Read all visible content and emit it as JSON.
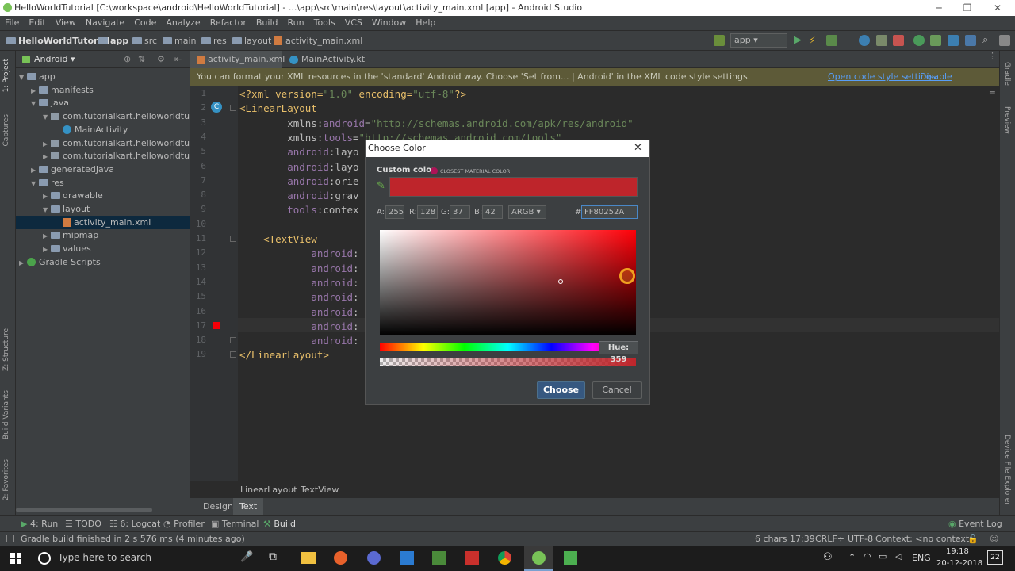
{
  "window": {
    "title": "HelloWorldTutorial [C:\\workspace\\android\\HelloWorldTutorial] - ...\\app\\src\\main\\res\\layout\\activity_main.xml [app] - Android Studio"
  },
  "menu": [
    "File",
    "Edit",
    "View",
    "Navigate",
    "Code",
    "Analyze",
    "Refactor",
    "Build",
    "Run",
    "Tools",
    "VCS",
    "Window",
    "Help"
  ],
  "breadcrumb": [
    "HelloWorldTutorial",
    "app",
    "src",
    "main",
    "res",
    "layout",
    "activity_main.xml"
  ],
  "run_config": "app",
  "left_strip": [
    "1: Project",
    "Captures",
    "Z: Structure",
    "Build Variants",
    "2: Favorites"
  ],
  "right_strip": [
    "Gradle",
    "Preview",
    "Device File Explorer"
  ],
  "project": {
    "view_mode": "Android",
    "tree": [
      {
        "label": "app",
        "depth": 0,
        "arrow": "▼",
        "icon": "folder"
      },
      {
        "label": "manifests",
        "depth": 1,
        "arrow": "▶",
        "icon": "folder"
      },
      {
        "label": "java",
        "depth": 1,
        "arrow": "▼",
        "icon": "folder"
      },
      {
        "label": "com.tutorialkart.helloworldtutorial",
        "depth": 2,
        "arrow": "▼",
        "icon": "pkg"
      },
      {
        "label": "MainActivity",
        "depth": 3,
        "arrow": "",
        "icon": "cls"
      },
      {
        "label": "com.tutorialkart.helloworldtutorial (",
        "depth": 2,
        "arrow": "▶",
        "icon": "pkg"
      },
      {
        "label": "com.tutorialkart.helloworldtutorial (",
        "depth": 2,
        "arrow": "▶",
        "icon": "pkg"
      },
      {
        "label": "generatedJava",
        "depth": 1,
        "arrow": "▶",
        "icon": "folder"
      },
      {
        "label": "res",
        "depth": 1,
        "arrow": "▼",
        "icon": "folder"
      },
      {
        "label": "drawable",
        "depth": 2,
        "arrow": "▶",
        "icon": "folder"
      },
      {
        "label": "layout",
        "depth": 2,
        "arrow": "▼",
        "icon": "folder"
      },
      {
        "label": "activity_main.xml",
        "depth": 3,
        "arrow": "",
        "icon": "xml",
        "selected": true
      },
      {
        "label": "mipmap",
        "depth": 2,
        "arrow": "▶",
        "icon": "folder"
      },
      {
        "label": "values",
        "depth": 2,
        "arrow": "▶",
        "icon": "folder"
      },
      {
        "label": "Gradle Scripts",
        "depth": 0,
        "arrow": "▶",
        "icon": "gradle"
      }
    ]
  },
  "editor_tabs": [
    "activity_main.xml",
    "MainActivity.kt"
  ],
  "notice": {
    "text": "You can format your XML resources in the 'standard' Android way. Choose 'Set from... | Android' in the XML code style settings.",
    "link1": "Open code style settings",
    "link2": "Disable notification"
  },
  "code_lines": [
    [
      [
        "<?xml version=",
        "tg"
      ],
      [
        "\"1.0\"",
        "str"
      ],
      [
        " encoding=",
        "tg"
      ],
      [
        "\"utf-8\"",
        "str"
      ],
      [
        "?>",
        "tg"
      ]
    ],
    [
      [
        "<LinearLayout",
        "tg"
      ]
    ],
    [
      [
        "        xmlns:",
        "at"
      ],
      [
        "android",
        "ns"
      ],
      [
        "=",
        "at"
      ],
      [
        "\"http://schemas.android.com/apk/res/android\"",
        "str"
      ]
    ],
    [
      [
        "        xmlns:",
        "at"
      ],
      [
        "tools",
        "ns"
      ],
      [
        "=",
        "at"
      ],
      [
        "\"http://schemas.android.com/tools\"",
        "str"
      ]
    ],
    [
      [
        "        ",
        "at"
      ],
      [
        "android",
        "ns"
      ],
      [
        ":layo",
        "at"
      ]
    ],
    [
      [
        "        ",
        "at"
      ],
      [
        "android",
        "ns"
      ],
      [
        ":layo",
        "at"
      ]
    ],
    [
      [
        "        ",
        "at"
      ],
      [
        "android",
        "ns"
      ],
      [
        ":orie",
        "at"
      ]
    ],
    [
      [
        "        ",
        "at"
      ],
      [
        "android",
        "ns"
      ],
      [
        ":grav",
        "at"
      ]
    ],
    [
      [
        "        ",
        "at"
      ],
      [
        "tools",
        "ns"
      ],
      [
        ":contex",
        "at"
      ]
    ],
    [
      [
        "",
        "at"
      ]
    ],
    [
      [
        "    <TextView",
        "tg"
      ]
    ],
    [
      [
        "            ",
        "at"
      ],
      [
        "android",
        "ns"
      ],
      [
        ":",
        "at"
      ]
    ],
    [
      [
        "            ",
        "at"
      ],
      [
        "android",
        "ns"
      ],
      [
        ":",
        "at"
      ]
    ],
    [
      [
        "            ",
        "at"
      ],
      [
        "android",
        "ns"
      ],
      [
        ":",
        "at"
      ]
    ],
    [
      [
        "            ",
        "at"
      ],
      [
        "android",
        "ns"
      ],
      [
        ":",
        "at"
      ]
    ],
    [
      [
        "            ",
        "at"
      ],
      [
        "android",
        "ns"
      ],
      [
        ":",
        "at"
      ]
    ],
    [
      [
        "            ",
        "at"
      ],
      [
        "android",
        "ns"
      ],
      [
        ":",
        "at"
      ]
    ],
    [
      [
        "            ",
        "at"
      ],
      [
        "android",
        "ns"
      ],
      [
        ":",
        "at"
      ]
    ],
    [
      [
        "</LinearLayout>",
        "tg"
      ]
    ]
  ],
  "editor_breadcrumb": [
    "LinearLayout",
    "TextView"
  ],
  "design_tabs": [
    "Design",
    "Text"
  ],
  "bottom_tools": [
    {
      "label": "4: Run"
    },
    {
      "label": "TODO"
    },
    {
      "label": "6: Logcat"
    },
    {
      "label": "Profiler"
    },
    {
      "label": "Terminal"
    },
    {
      "label": "Build"
    },
    {
      "label": "Event Log"
    }
  ],
  "status": {
    "message": "Gradle build finished in 2 s 576 ms (4 minutes ago)",
    "chars": "6 chars",
    "position": "17:39",
    "line_sep": "CRLF÷",
    "encoding": "UTF-8",
    "context": "Context: <no context>"
  },
  "dialog": {
    "title": "Choose Color",
    "custom_label": "Custom color",
    "closest_label": "CLOSEST MATERIAL COLOR",
    "a_label": "A:",
    "a_value": "255",
    "r_label": "R:",
    "r_value": "128",
    "g_label": "G:",
    "g_value": "37",
    "b_label": "B:",
    "b_value": "42",
    "mode": "ARGB",
    "hash": "#",
    "hex_value": "FF80252A",
    "hue_tooltip": "Hue: 359",
    "hue_value": 359,
    "choose_label": "Choose",
    "cancel_label": "Cancel",
    "preview_color": "#be252b",
    "closest_color": "#ad1457"
  },
  "taskbar": {
    "search_placeholder": "Type here to search",
    "lang": "ENG",
    "time": "19:18",
    "date": "20-12-2018",
    "notif_count": "22"
  }
}
